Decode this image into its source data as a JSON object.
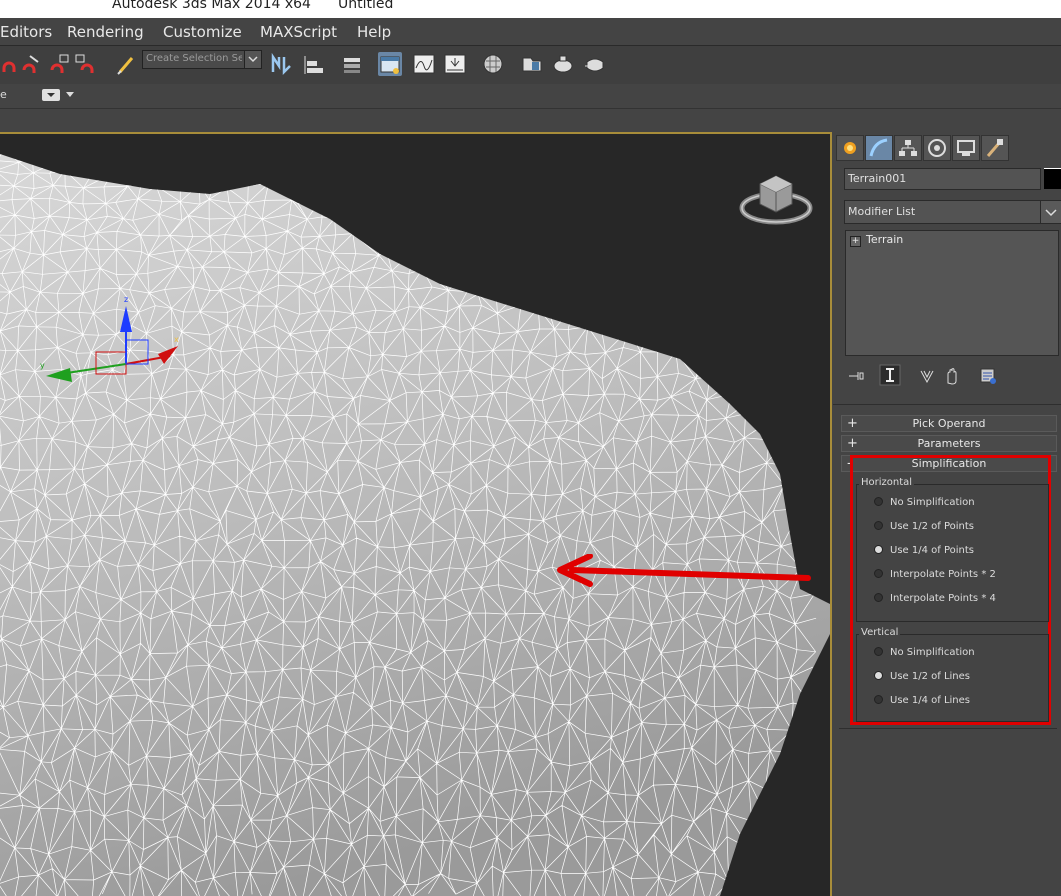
{
  "window": {
    "app_title": "Autodesk 3ds Max  2014 x64",
    "doc_title": "Untitled"
  },
  "menu": [
    "Editors",
    "Rendering",
    "Customize",
    "MAXScript",
    "Help"
  ],
  "toolbar": {
    "selection_set_placeholder": "Create Selection Se"
  },
  "subbar": {
    "left_text": "e"
  },
  "command_panel": {
    "object_name": "Terrain001",
    "modifier_list": "Modifier List",
    "stack_item": "Terrain",
    "stack_expand": "+"
  },
  "rollouts": [
    {
      "sign": "+",
      "label": "Pick Operand"
    },
    {
      "sign": "+",
      "label": "Parameters"
    },
    {
      "sign": "-",
      "label": "Simplification"
    }
  ],
  "simplification": {
    "horizontal": {
      "title": "Horizontal",
      "options": [
        "No Simplification",
        "Use 1/2 of Points",
        "Use 1/4 of Points",
        "Interpolate Points * 2",
        "Interpolate Points * 4"
      ],
      "selected": "Use 1/4 of Points"
    },
    "vertical": {
      "title": "Vertical",
      "options": [
        "No Simplification",
        "Use 1/2 of Lines",
        "Use 1/4 of Lines"
      ],
      "selected": "Use 1/2 of Lines"
    }
  },
  "colors": {
    "highlight": "#e00000",
    "active_tab": "#6a87a6",
    "viewport_border": "#a88d3a"
  }
}
